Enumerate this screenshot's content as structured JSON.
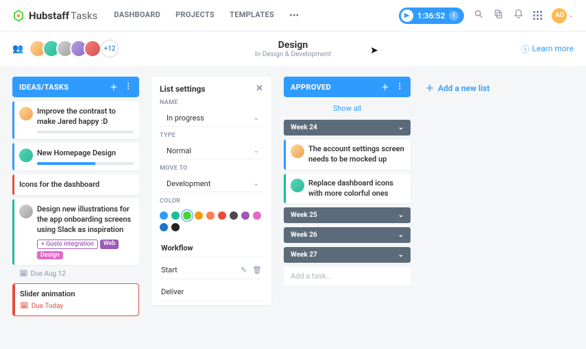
{
  "brand": {
    "name": "Hubstaff",
    "suffix": "Tasks"
  },
  "nav": {
    "items": [
      "DASHBOARD",
      "PROJECTS",
      "TEMPLATES"
    ]
  },
  "timer": {
    "value": "1:36:52"
  },
  "user_initials": "AO",
  "header": {
    "title": "Design",
    "subtitle": "In Design & Development",
    "avatar_more": "+12",
    "learn_more": "Learn more"
  },
  "lists": {
    "ideas": {
      "title": "IDEAS/TASKS",
      "cards": [
        {
          "title": "Improve the contrast to make Jared happy :D",
          "progress": 0
        },
        {
          "title": "New Homepage Design",
          "progress": 60
        },
        {
          "title": "Icons for the dashboard",
          "progress": 0
        },
        {
          "title": "Design new illustrations for the app onboarding screens using Slack as inspiration",
          "tags": [
            "Gusto integration",
            "Web",
            "Design"
          ],
          "due": "Due Aug 12",
          "progress": 0
        },
        {
          "title": "Slider animation",
          "due_red": "Due Today"
        }
      ]
    },
    "approved": {
      "title": "APPROVED",
      "show_all": "Show all",
      "weeks": [
        {
          "label": "Week 24",
          "open": true,
          "cards": [
            {
              "title": "The account settings screen needs to be mocked up"
            },
            {
              "title": "Replace dashboard icons with more colorful ones"
            }
          ]
        },
        {
          "label": "Week 25",
          "open": false
        },
        {
          "label": "Week 26",
          "open": false
        },
        {
          "label": "Week 27",
          "open": false
        }
      ],
      "add_task_placeholder": "Add a task..."
    }
  },
  "settings": {
    "title": "List settings",
    "labels": {
      "name": "NAME",
      "type": "TYPE",
      "move_to": "MOVE TO",
      "color": "COLOR"
    },
    "name_value": "In progress",
    "type_value": "Normal",
    "move_to_value": "Development",
    "colors": [
      "#2f9bff",
      "#1abc9c",
      "#4cd137",
      "#f39c12",
      "#ff7f50",
      "#e74c3c",
      "#4a4a4a",
      "#9b59b6",
      "#e667c8",
      "#1d72d1",
      "#222222"
    ],
    "selected_color_index": 2,
    "workflow_label": "Workflow",
    "workflow": [
      "Start",
      "Deliver"
    ]
  },
  "add_list_label": "Add a new list"
}
